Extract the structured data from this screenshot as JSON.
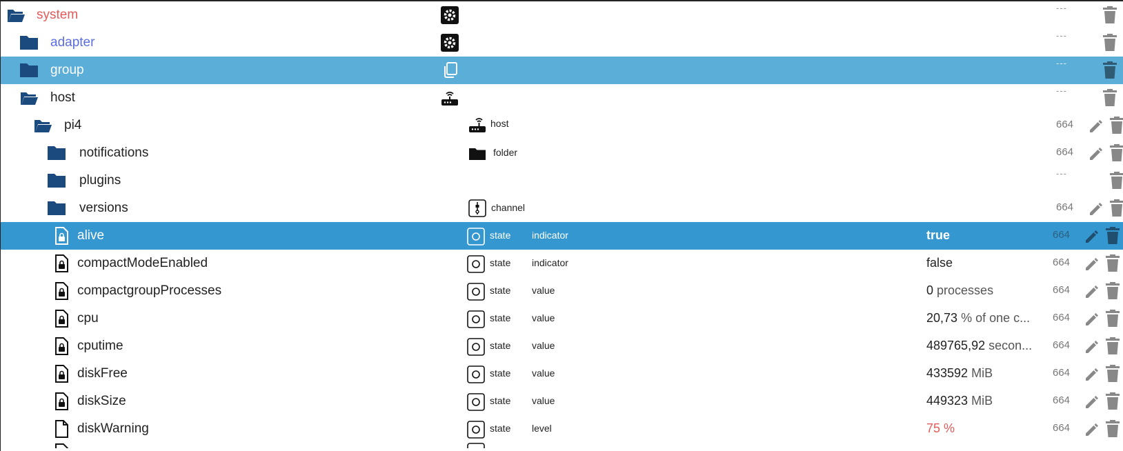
{
  "colors": {
    "folder": "#1a4a7e",
    "selected_light": "#5aaed8",
    "selected_dark": "#3597cf",
    "warning_text": "#e35a5a",
    "adapter_text": "#5b6ee1",
    "action_icon": "#888888"
  },
  "rows": [
    {
      "name": "system",
      "icon": "folder-open-icon",
      "role_icon": "gear-icon",
      "acl": "---",
      "edit": false
    },
    {
      "name": "adapter",
      "icon": "folder-icon",
      "role_icon": "gear-icon",
      "acl": "---",
      "edit": false
    },
    {
      "name": "group",
      "icon": "folder-icon",
      "role_icon": "copy-icon",
      "acl": "---",
      "edit": false
    },
    {
      "name": "host",
      "icon": "folder-open-icon",
      "role_icon": "router-icon",
      "acl": "---",
      "edit": false
    },
    {
      "name": "pi4",
      "icon": "folder-open-icon",
      "type_icon": "router-icon",
      "type": "host",
      "acl": "664",
      "edit": true
    },
    {
      "name": "notifications",
      "icon": "folder-icon",
      "type_icon": "folder-icon",
      "type": "folder",
      "acl": "664",
      "edit": true
    },
    {
      "name": "plugins",
      "icon": "folder-icon",
      "acl": "---",
      "edit": false
    },
    {
      "name": "versions",
      "icon": "folder-icon",
      "type_icon": "channel-icon",
      "type": "channel",
      "acl": "664",
      "edit": true
    },
    {
      "name": "alive",
      "icon": "file-lock-icon",
      "type_icon": "state-icon",
      "type": "state",
      "role": "indicator",
      "value": "true",
      "acl": "664",
      "edit": true
    },
    {
      "name": "compactModeEnabled",
      "icon": "file-lock-icon",
      "type_icon": "state-icon",
      "type": "state",
      "role": "indicator",
      "value": "false",
      "acl": "664",
      "edit": true
    },
    {
      "name": "compactgroupProcesses",
      "icon": "file-lock-icon",
      "type_icon": "state-icon",
      "type": "state",
      "role": "value",
      "value": "0",
      "unit": "processes",
      "acl": "664",
      "edit": true
    },
    {
      "name": "cpu",
      "icon": "file-lock-icon",
      "type_icon": "state-icon",
      "type": "state",
      "role": "value",
      "value": "20,73",
      "unit": "% of one c...",
      "acl": "664",
      "edit": true
    },
    {
      "name": "cputime",
      "icon": "file-lock-icon",
      "type_icon": "state-icon",
      "type": "state",
      "role": "value",
      "value": "489765,92",
      "unit": "secon...",
      "acl": "664",
      "edit": true
    },
    {
      "name": "diskFree",
      "icon": "file-lock-icon",
      "type_icon": "state-icon",
      "type": "state",
      "role": "value",
      "value": "433592",
      "unit": "MiB",
      "acl": "664",
      "edit": true
    },
    {
      "name": "diskSize",
      "icon": "file-lock-icon",
      "type_icon": "state-icon",
      "type": "state",
      "role": "value",
      "value": "449323",
      "unit": "MiB",
      "acl": "664",
      "edit": true
    },
    {
      "name": "diskWarning",
      "icon": "file-icon",
      "type_icon": "state-icon",
      "type": "state",
      "role": "level",
      "value": "75 %",
      "acl": "664",
      "edit": true
    }
  ]
}
